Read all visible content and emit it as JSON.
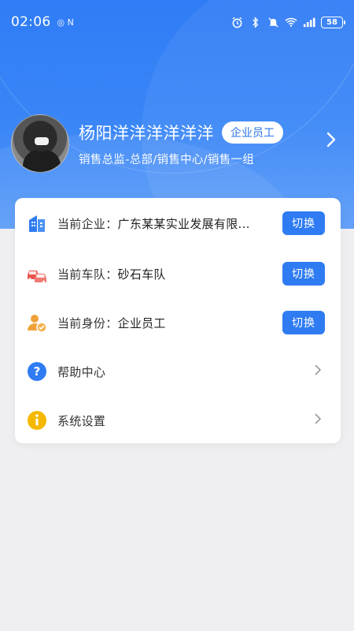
{
  "status_bar": {
    "time": "02:06",
    "small_icons": "◎ N",
    "battery": "58"
  },
  "profile": {
    "name": "杨阳洋洋洋洋洋洋",
    "role_badge": "企业员工",
    "department": "销售总监-总部/销售中心/销售一组"
  },
  "menu": {
    "company": {
      "label": "当前企业：",
      "value": "广东某某实业发展有限...",
      "button": "切换"
    },
    "fleet": {
      "label": "当前车队：",
      "value": "砂石车队",
      "button": "切换"
    },
    "identity": {
      "label": "当前身份：",
      "value": "企业员工",
      "button": "切换"
    },
    "help": {
      "label": "帮助中心"
    },
    "settings": {
      "label": "系统设置"
    }
  },
  "colors": {
    "header": "#2f7cf6",
    "accent": "#2f7cf2",
    "fleet_icon": "#e8544e",
    "identity_icon": "#f0a23a",
    "help_icon": "#2f7cf2",
    "settings_icon": "#f5b800"
  }
}
